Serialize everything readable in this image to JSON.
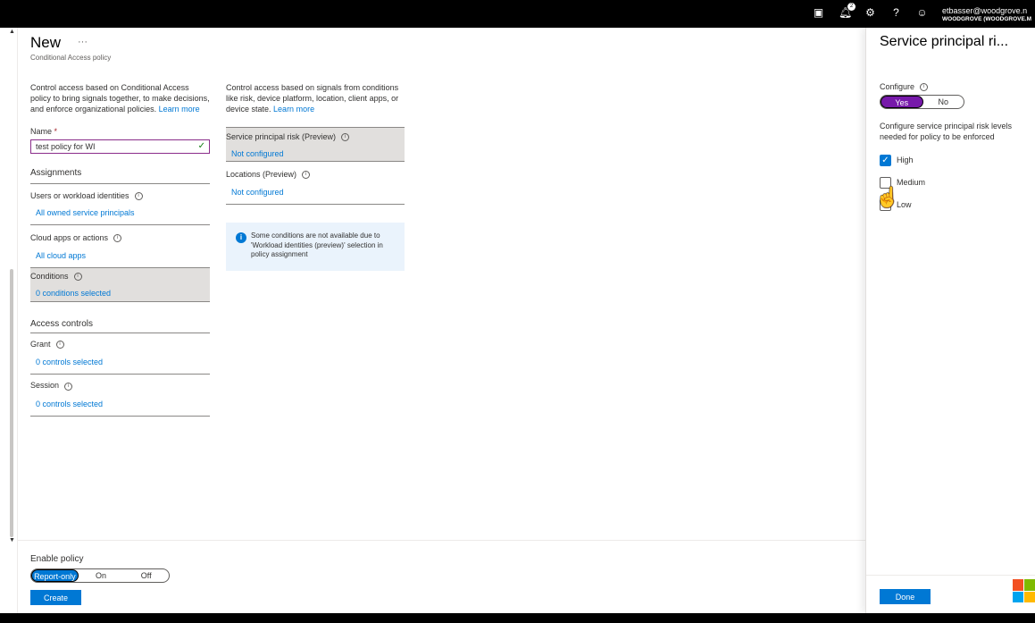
{
  "topbar": {
    "icons": [
      "cloud-shell-icon",
      "notifications-icon",
      "settings-icon",
      "help-icon",
      "feedback-icon"
    ],
    "notification_count": "2",
    "user_email": "etbasser@woodgrove.n",
    "user_tenant": "WOODGROVE (WOODGROVE.M"
  },
  "page": {
    "title": "New",
    "ellipsis": "···",
    "subtitle": "Conditional Access policy"
  },
  "left": {
    "description": "Control access based on Conditional Access policy to bring signals together, to make decisions, and enforce organizational policies.",
    "learn_more": "Learn more",
    "name_label": "Name",
    "name_required": "*",
    "name_value": "test policy for WI",
    "assignments": "Assignments",
    "users_label": "Users or workload identities",
    "users_value": "All owned service principals",
    "cloud_label": "Cloud apps or actions",
    "cloud_value": "All cloud apps",
    "conditions_label": "Conditions",
    "conditions_value": "0 conditions selected",
    "access_controls": "Access controls",
    "grant_label": "Grant",
    "grant_value": "0 controls selected",
    "session_label": "Session",
    "session_value": "0 controls selected"
  },
  "middle": {
    "description": "Control access based on signals from conditions like risk, device platform, location, client apps, or device state.",
    "learn_more": "Learn more",
    "sp_risk_label": "Service principal risk (Preview)",
    "sp_risk_value": "Not configured",
    "locations_label": "Locations (Preview)",
    "locations_value": "Not configured",
    "notice": "Some conditions are not available due to 'Workload identities (preview)' selection in policy assignment"
  },
  "footer": {
    "enable_policy": "Enable policy",
    "options": [
      "Report-only",
      "On",
      "Off"
    ],
    "selected": "Report-only",
    "create": "Create"
  },
  "panel": {
    "title": "Service principal ri...",
    "configure_label": "Configure",
    "yes": "Yes",
    "no": "No",
    "selected": "Yes",
    "description": "Configure service principal risk levels needed for policy to be enforced",
    "levels": [
      {
        "label": "High",
        "checked": true
      },
      {
        "label": "Medium",
        "checked": false
      },
      {
        "label": "Low",
        "checked": false
      }
    ],
    "done": "Done"
  },
  "colors": {
    "accent": "#0078d4",
    "toggle_yes": "#7719aa",
    "name_border": "#8a2d8a"
  }
}
